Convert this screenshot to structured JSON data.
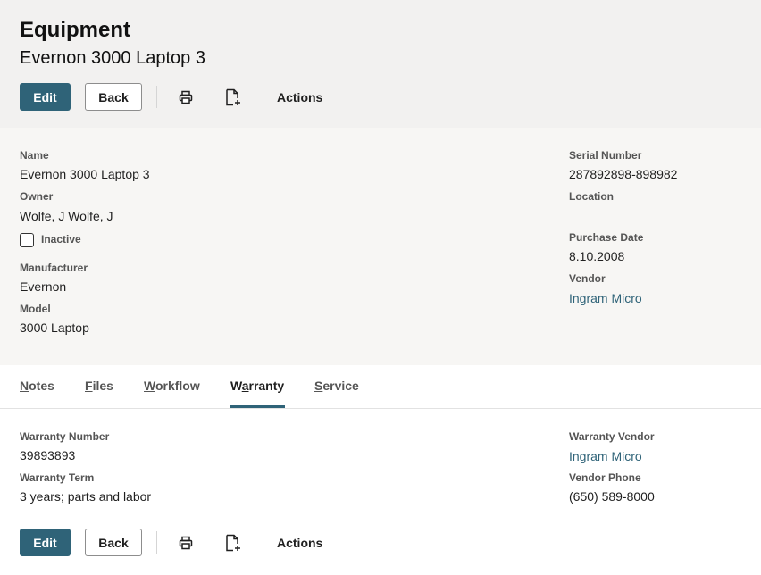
{
  "header": {
    "title": "Equipment",
    "subtitle": "Evernon 3000 Laptop 3"
  },
  "toolbar": {
    "edit_label": "Edit",
    "back_label": "Back",
    "actions_label": "Actions",
    "print_icon": "printer-icon",
    "new_doc_icon": "new-document-icon"
  },
  "details": {
    "name_label": "Name",
    "name_value": "Evernon 3000 Laptop 3",
    "owner_label": "Owner",
    "owner_value": "Wolfe, J Wolfe, J",
    "inactive_label": "Inactive",
    "manufacturer_label": "Manufacturer",
    "manufacturer_value": "Evernon",
    "model_label": "Model",
    "model_value": "3000 Laptop",
    "serial_label": "Serial Number",
    "serial_value": "287892898-898982",
    "location_label": "Location",
    "purchase_date_label": "Purchase Date",
    "purchase_date_value": "8.10.2008",
    "vendor_label": "Vendor",
    "vendor_value": "Ingram Micro"
  },
  "tabs": [
    {
      "pre": "",
      "key": "N",
      "rest": "otes"
    },
    {
      "pre": "",
      "key": "F",
      "rest": "iles"
    },
    {
      "pre": "",
      "key": "W",
      "rest": "orkflow"
    },
    {
      "pre": "W",
      "key": "a",
      "rest": "rranty",
      "active": true
    },
    {
      "pre": "",
      "key": "S",
      "rest": "ervice"
    }
  ],
  "warranty": {
    "number_label": "Warranty Number",
    "number_value": "39893893",
    "term_label": "Warranty Term",
    "term_value": "3 years; parts and labor",
    "vendor_label": "Warranty Vendor",
    "vendor_value": "Ingram Micro",
    "phone_label": "Vendor Phone",
    "phone_value": "(650) 589-8000"
  },
  "colors": {
    "accent": "#2f6378",
    "header_bg": "#f2f1f0",
    "detail_bg": "#f7f6f4"
  }
}
